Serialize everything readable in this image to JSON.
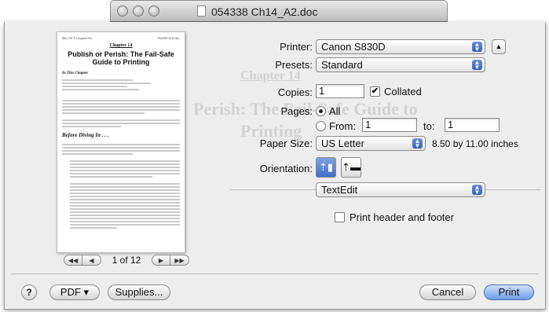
{
  "window": {
    "title": "054338 Ch14_A2.doc"
  },
  "preview": {
    "header_left": "Mac OS X Leopard For",
    "header_right": "054338 Ch14.doc",
    "chapter": "Chapter 14",
    "heading": "Publish or Perish: The Fail-Safe Guide to Printing",
    "section1": "In This Chapter",
    "section2": "Before Diving In . . ."
  },
  "pager": {
    "first_label": "◀◀",
    "prev_label": "◀",
    "page_text": "1 of 12",
    "next_label": "▶",
    "last_label": "▶▶"
  },
  "form": {
    "printer_label": "Printer:",
    "printer_value": "Canon S830D",
    "presets_label": "Presets:",
    "presets_value": "Standard",
    "copies_label": "Copies:",
    "copies_value": "1",
    "collated_label": "Collated",
    "pages_label": "Pages:",
    "all_label": "All",
    "from_label": "From:",
    "from_value": "1",
    "to_label": "to:",
    "to_value": "1",
    "paper_label": "Paper Size:",
    "paper_value": "US Letter",
    "paper_dims": "8.50 by 11.00 inches",
    "orientation_label": "Orientation:",
    "panel_value": "TextEdit",
    "header_footer_label": "Print header and footer"
  },
  "buttons": {
    "help": "?",
    "pdf": "PDF ▾",
    "supplies": "Supplies...",
    "cancel": "Cancel",
    "print": "Print"
  },
  "background_doc": {
    "chapter": "Chapter 14",
    "heading_line1": "Perish: The Fail-Safe Guide to",
    "heading_line2": "Printing"
  }
}
